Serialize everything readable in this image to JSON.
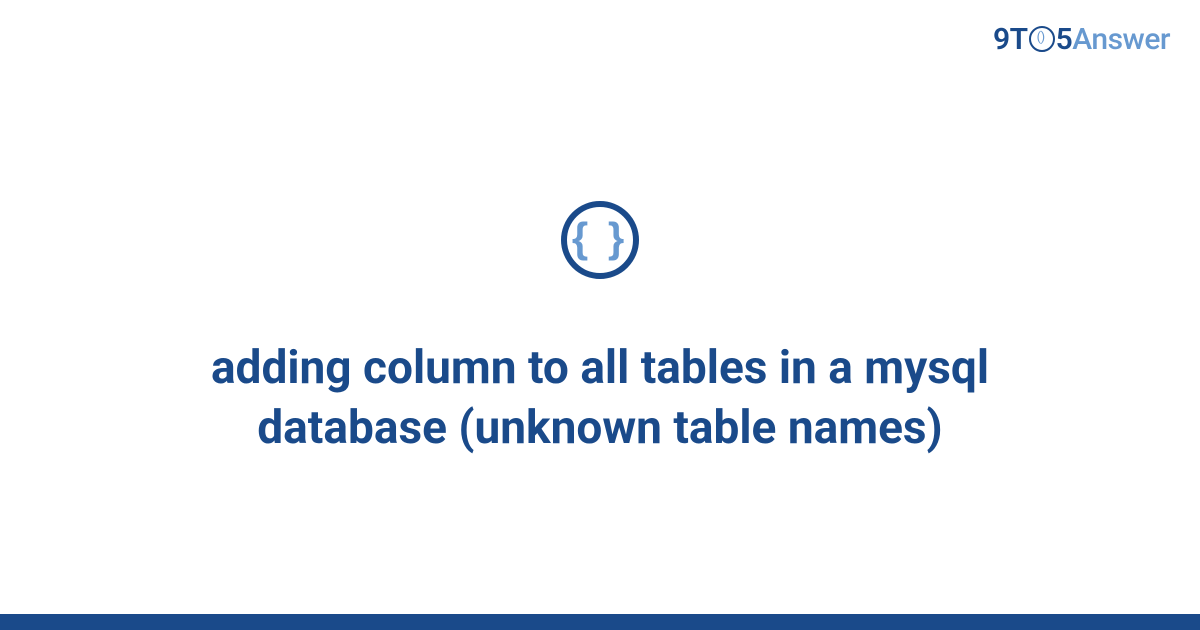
{
  "logo": {
    "part1": "9T",
    "clock_inner": "()",
    "part2": "5",
    "part3": "Answer"
  },
  "icon": {
    "braces": "{ }"
  },
  "title": "adding column to all tables in a mysql database (unknown table names)",
  "colors": {
    "primary": "#1a4a8a",
    "secondary": "#6799d0"
  }
}
